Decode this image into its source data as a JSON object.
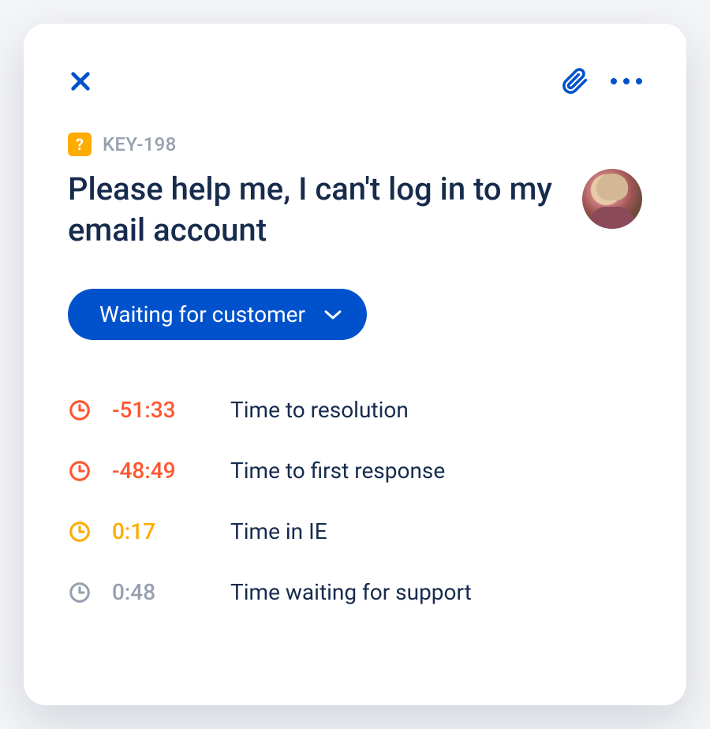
{
  "issue": {
    "key": "KEY-198",
    "title": "Please help me, I can't log in to my email account"
  },
  "status": {
    "label": "Waiting for customer"
  },
  "sla": [
    {
      "value": "-51:33",
      "label": "Time to resolution",
      "state": "breached"
    },
    {
      "value": "-48:49",
      "label": "Time to first response",
      "state": "breached"
    },
    {
      "value": "0:17",
      "label": "Time in IE",
      "state": "warning"
    },
    {
      "value": "0:48",
      "label": "Time waiting for support",
      "state": "ok"
    }
  ],
  "colors": {
    "breached": "#ff5630",
    "warning": "#ffab00",
    "ok": "#97a0af",
    "accent": "#0052cc"
  }
}
